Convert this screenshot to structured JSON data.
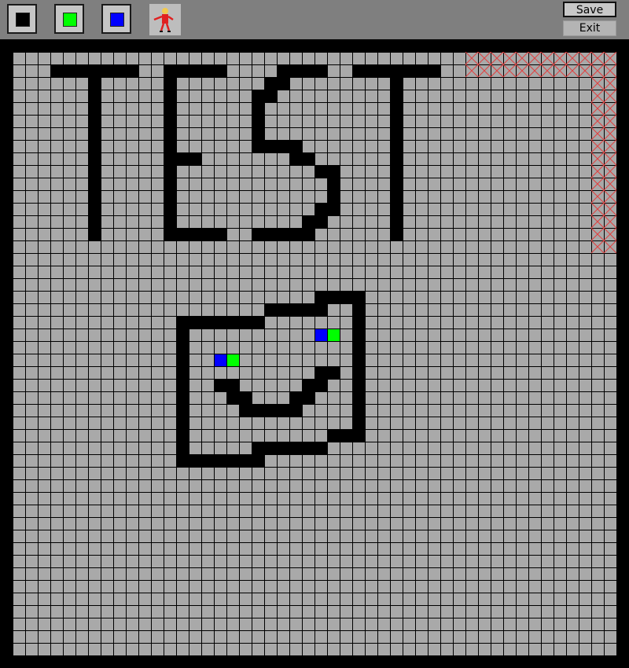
{
  "toolbar": {
    "tools": [
      {
        "name": "black-color-tool",
        "color": "#000000"
      },
      {
        "name": "green-color-tool",
        "color": "#00ff00"
      },
      {
        "name": "blue-color-tool",
        "color": "#0000ff"
      }
    ],
    "sprite_icon": "character-sprite-icon",
    "save_label": "Save",
    "exit_label": "Exit"
  },
  "board": {
    "cols": 48,
    "rows": 48,
    "colors": {
      "empty": "#a9a9a9",
      "grid": "#000000",
      "wall": "#000000",
      "blocked_x": "#e04040"
    },
    "wall_rects": [
      [
        3,
        1,
        7,
        1
      ],
      [
        6,
        2,
        1,
        13
      ],
      [
        12,
        1,
        5,
        1
      ],
      [
        12,
        2,
        1,
        13
      ],
      [
        13,
        8,
        2,
        1
      ],
      [
        13,
        14,
        4,
        1
      ],
      [
        21,
        1,
        4,
        1
      ],
      [
        20,
        2,
        2,
        1
      ],
      [
        19,
        3,
        2,
        1
      ],
      [
        19,
        4,
        1,
        4
      ],
      [
        19,
        7,
        4,
        1
      ],
      [
        22,
        8,
        2,
        1
      ],
      [
        24,
        9,
        2,
        1
      ],
      [
        25,
        10,
        1,
        3
      ],
      [
        24,
        12,
        2,
        1
      ],
      [
        23,
        13,
        2,
        1
      ],
      [
        19,
        14,
        5,
        1
      ],
      [
        27,
        1,
        7,
        1
      ],
      [
        30,
        2,
        1,
        13
      ],
      [
        24,
        19,
        4,
        1
      ],
      [
        20,
        20,
        5,
        1
      ],
      [
        13,
        21,
        7,
        1
      ],
      [
        27,
        20,
        1,
        11
      ],
      [
        25,
        30,
        2,
        1
      ],
      [
        19,
        31,
        6,
        1
      ],
      [
        19,
        32,
        1,
        1
      ],
      [
        13,
        22,
        1,
        11
      ],
      [
        14,
        32,
        6,
        1
      ],
      [
        16,
        26,
        2,
        1
      ],
      [
        17,
        27,
        2,
        1
      ],
      [
        18,
        28,
        5,
        1
      ],
      [
        22,
        27,
        2,
        1
      ],
      [
        23,
        26,
        2,
        1
      ],
      [
        24,
        25,
        2,
        1
      ]
    ],
    "green_cells": [
      [
        25,
        22
      ],
      [
        17,
        24
      ]
    ],
    "blue_cells": [
      [
        24,
        22
      ],
      [
        16,
        24
      ]
    ],
    "blocked_cells": [
      [
        36,
        0
      ],
      [
        37,
        0
      ],
      [
        38,
        0
      ],
      [
        39,
        0
      ],
      [
        40,
        0
      ],
      [
        41,
        0
      ],
      [
        42,
        0
      ],
      [
        43,
        0
      ],
      [
        44,
        0
      ],
      [
        45,
        0
      ],
      [
        46,
        0
      ],
      [
        47,
        0
      ],
      [
        36,
        1
      ],
      [
        37,
        1
      ],
      [
        38,
        1
      ],
      [
        39,
        1
      ],
      [
        40,
        1
      ],
      [
        41,
        1
      ],
      [
        42,
        1
      ],
      [
        43,
        1
      ],
      [
        44,
        1
      ],
      [
        45,
        1
      ],
      [
        46,
        1
      ],
      [
        47,
        1
      ],
      [
        46,
        2
      ],
      [
        47,
        2
      ],
      [
        46,
        3
      ],
      [
        47,
        3
      ],
      [
        46,
        4
      ],
      [
        47,
        4
      ],
      [
        46,
        5
      ],
      [
        47,
        5
      ],
      [
        46,
        6
      ],
      [
        47,
        6
      ],
      [
        46,
        7
      ],
      [
        47,
        7
      ],
      [
        46,
        8
      ],
      [
        47,
        8
      ],
      [
        46,
        9
      ],
      [
        47,
        9
      ],
      [
        46,
        10
      ],
      [
        47,
        10
      ],
      [
        46,
        11
      ],
      [
        47,
        11
      ],
      [
        46,
        12
      ],
      [
        47,
        12
      ],
      [
        46,
        13
      ],
      [
        47,
        13
      ],
      [
        46,
        14
      ],
      [
        47,
        14
      ],
      [
        46,
        15
      ],
      [
        47,
        15
      ]
    ]
  }
}
